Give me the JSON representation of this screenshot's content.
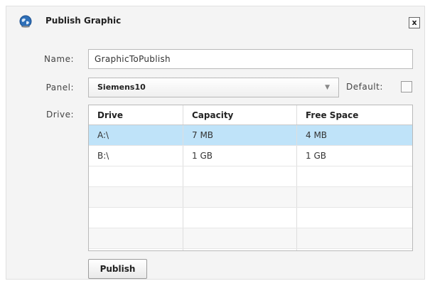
{
  "dialog": {
    "title": "Publish Graphic",
    "close_label": "x"
  },
  "form": {
    "name_label": "Name:",
    "name_value": "GraphicToPublish",
    "panel_label": "Panel:",
    "panel_value": "Siemens10",
    "default_label": "Default:",
    "default_checked": false,
    "drive_label": "Drive:"
  },
  "drives": {
    "columns": [
      "Drive",
      "Capacity",
      "Free Space"
    ],
    "rows": [
      {
        "drive": "A:\\",
        "capacity": "7 MB",
        "free": "4 MB",
        "selected": true
      },
      {
        "drive": "B:\\",
        "capacity": "1 GB",
        "free": "1 GB",
        "selected": false
      }
    ]
  },
  "actions": {
    "publish_label": "Publish"
  },
  "colors": {
    "selected_row": "#bfe3f9",
    "dialog_bg": "#f4f4f4"
  },
  "icons": {
    "title": "globe-icon",
    "dropdown": "chevron-down-icon"
  }
}
